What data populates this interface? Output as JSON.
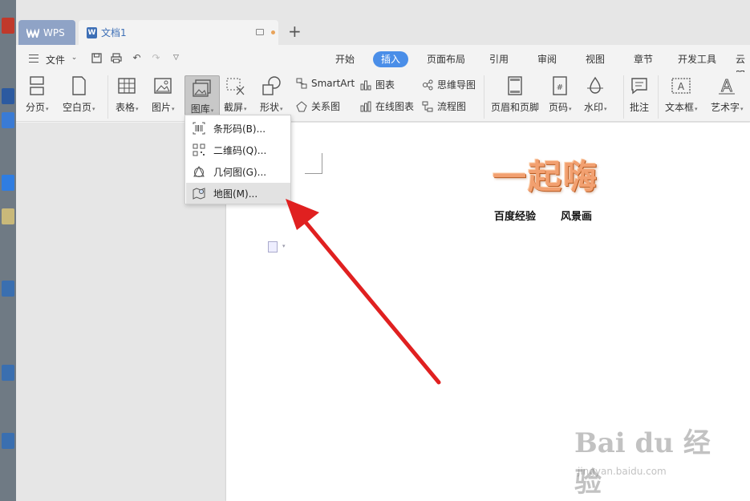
{
  "window": {
    "tabs": [
      {
        "label": "WPS"
      },
      {
        "label": "文档1"
      }
    ],
    "new_tab": "+"
  },
  "menubar": {
    "file_label": "文件",
    "ribbon_tabs": [
      "开始",
      "插入",
      "页面布局",
      "引用",
      "审阅",
      "视图",
      "章节",
      "开发工具",
      "云服"
    ],
    "active_tab": "插入"
  },
  "toolbar": {
    "page_break": "分页",
    "blank_page": "空白页",
    "table": "表格",
    "picture": "图片",
    "gallery": "图库",
    "screenshot": "截屏",
    "shapes": "形状",
    "smartart": "SmartArt",
    "chart": "图表",
    "mindmap": "思维导图",
    "relation": "关系图",
    "online_chart": "在线图表",
    "flowchart": "流程图",
    "header_footer": "页眉和页脚",
    "page_number": "页码",
    "watermark": "水印",
    "comment": "批注",
    "textbox": "文本框",
    "wordart": "艺术字"
  },
  "gallery_menu": {
    "items": [
      {
        "label": "条形码(B)...",
        "icon": "barcode-icon"
      },
      {
        "label": "二维码(Q)...",
        "icon": "qrcode-icon"
      },
      {
        "label": "几何图(G)...",
        "icon": "geometry-icon"
      },
      {
        "label": "地图(M)...",
        "icon": "map-icon"
      }
    ],
    "highlighted": "地图(M)..."
  },
  "document": {
    "wordart_text": "一起嗨",
    "subtitle_left": "百度经验",
    "subtitle_right": "风景画"
  },
  "watermark": {
    "main": "Bai du 经验",
    "sub": "jingyan.baidu.com"
  },
  "colors": {
    "accent": "#4a8ee8",
    "arrow": "#e02020",
    "wordart": "#f2a070"
  }
}
